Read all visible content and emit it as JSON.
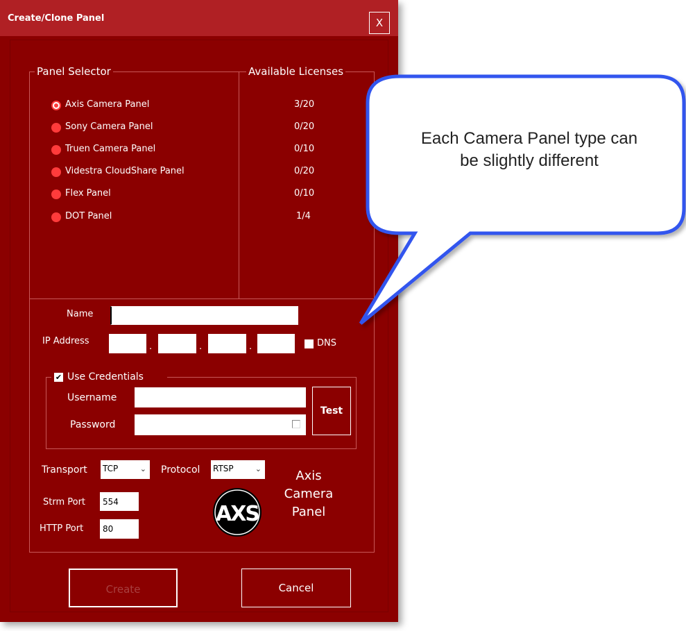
{
  "window": {
    "title": "Create/Clone Panel",
    "close_label": "X"
  },
  "panel_selector": {
    "legend": "Panel Selector",
    "options": [
      {
        "label": "Axis Camera Panel",
        "checked": true
      },
      {
        "label": "Sony Camera Panel",
        "checked": false
      },
      {
        "label": "Truen Camera Panel",
        "checked": false
      },
      {
        "label": "Videstra CloudShare Panel",
        "checked": false
      },
      {
        "label": "Flex Panel",
        "checked": false
      },
      {
        "label": "DOT Panel",
        "checked": false
      }
    ]
  },
  "licenses": {
    "legend": "Available Licenses",
    "values": [
      "3/20",
      "0/20",
      "0/10",
      "0/20",
      "0/10",
      "1/4"
    ]
  },
  "form": {
    "name_label": "Name",
    "name_value": "",
    "ip_label": "IP Address",
    "ip_dot": ".",
    "ip_octets": [
      "",
      "",
      "",
      ""
    ],
    "dns_label": "DNS",
    "dns_checked": false,
    "credentials": {
      "legend": "Use Credentials",
      "checked": true,
      "check_glyph": "✔",
      "username_label": "Username",
      "username_value": "",
      "password_label": "Password",
      "password_value": "",
      "test_label": "Test"
    },
    "transport_label": "Transport",
    "transport_value": "TCP",
    "protocol_label": "Protocol",
    "protocol_value": "RTSP",
    "dropdown_glyph": "⌄",
    "strm_port_label": "Strm Port",
    "strm_port_value": "554",
    "http_port_label": "HTTP Port",
    "http_port_value": "80"
  },
  "logo": {
    "icon": "axs-logo",
    "caption_lines": [
      "Axis",
      "Camera",
      "Panel"
    ]
  },
  "buttons": {
    "create_label": "Create",
    "cancel_label": "Cancel"
  },
  "callout": {
    "lines": [
      "Each Camera Panel type can",
      "be slightly different"
    ]
  },
  "colors": {
    "window_bg": "#8b0000",
    "titlebar_bg": "#b02024",
    "radio": "#ff3b3b",
    "callout_border": "#3355ee"
  }
}
